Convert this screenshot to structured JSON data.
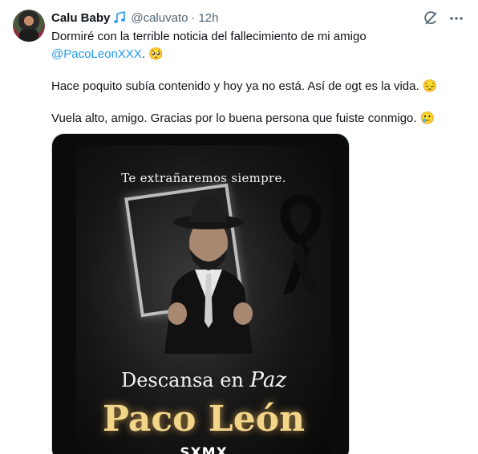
{
  "tweet": {
    "display_name": "Calu Baby",
    "badge_icon": "music-notes-icon",
    "handle": "@caluvato",
    "separator": "·",
    "time": "12h",
    "text": {
      "line1": "Dormiré con la terrible noticia del fallecimiento de mi amigo",
      "mention": "@PacoLeonXXX",
      "mention_suffix": ". 🥺",
      "para2": "Hace poquito subía contenido y hoy ya no está. Así de ogt es la vida. 😔",
      "para3": "Vuela alto, amigo. Gracias por lo buena persona que fuiste conmigo. 🥲"
    },
    "actions": [
      "grok-icon",
      "more-icon"
    ],
    "media": {
      "top_text": "Te extrañaremos siempre.",
      "rest_text": "Descansa en",
      "paz_text": "Paz",
      "name_text": "Paco León",
      "brand_text": "SXMX"
    }
  },
  "colors": {
    "text": "#0f1419",
    "secondary": "#536471",
    "link": "#1d9bf0",
    "gold": "#f3d58a"
  }
}
